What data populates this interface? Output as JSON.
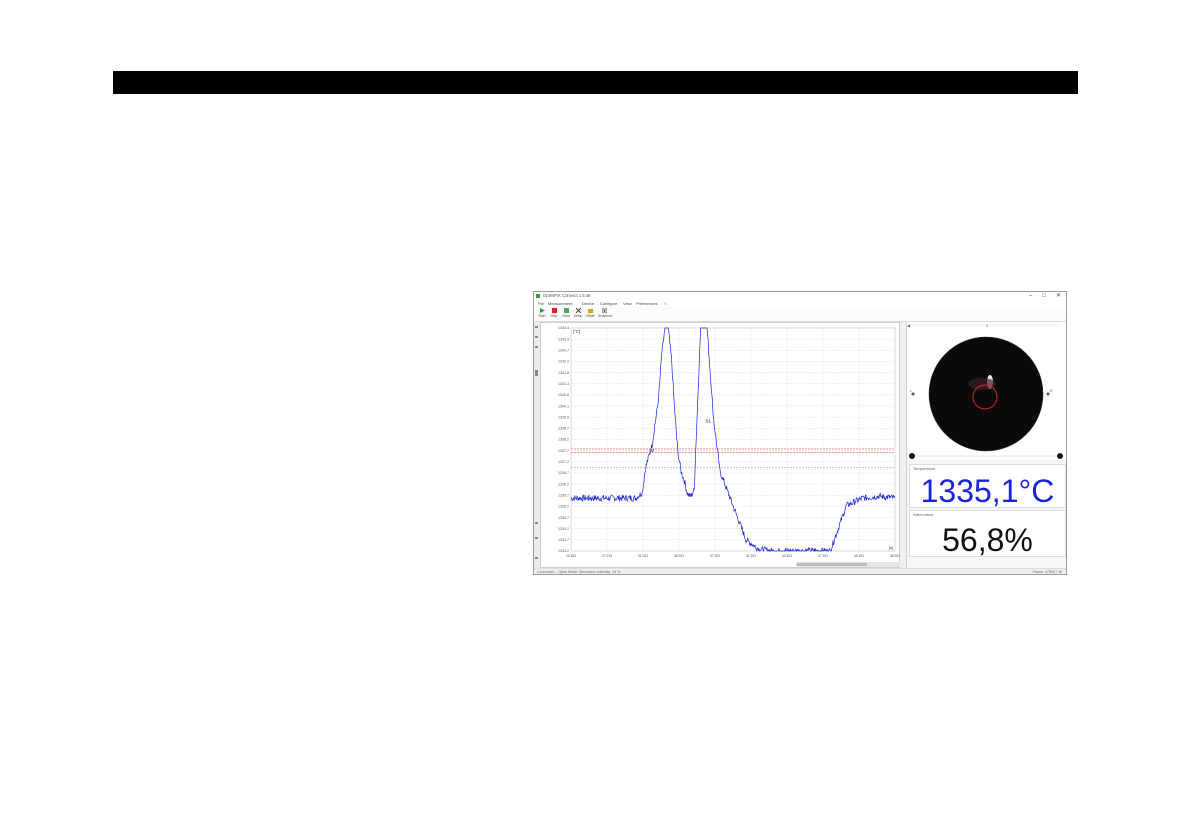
{
  "window": {
    "title": "OptrisPIX Connect 1.5.48",
    "controls": [
      "–",
      "□",
      "✕"
    ]
  },
  "menu": [
    "File",
    "Measurement",
    "Device",
    "Configure",
    "View",
    "Preferences",
    "?"
  ],
  "toolbar": [
    {
      "label": "Start",
      "icon": "play-icon",
      "color": "#1aa32a"
    },
    {
      "label": "Stop",
      "icon": "stop-icon",
      "color": "#e02020"
    },
    {
      "label": "Clear",
      "icon": "clear-icon",
      "color": "#4caf50"
    },
    {
      "label": "Setup",
      "icon": "tools-icon",
      "color": "#444444"
    },
    {
      "label": "Offset",
      "icon": "offset-icon",
      "color": "#e0a000"
    },
    {
      "label": "Snapshot",
      "icon": "camera-icon",
      "color": "#444444"
    }
  ],
  "plot": {
    "unit_label": "[°C]",
    "x_unit_label": "[s]"
  },
  "chart_data": {
    "type": "line",
    "title": "",
    "xlabel": "[s]",
    "ylabel": "[°C]",
    "ylim": [
      1332.8,
      1344.6
    ],
    "yticks": [
      "1344.4",
      "1343.5",
      "1342.7",
      "1342.2",
      "1341.8",
      "1341.3",
      "1340.8",
      "1340.1",
      "1339.5",
      "1338.7",
      "1338.2",
      "1337.7",
      "1337.2",
      "1336.7",
      "1336.2",
      "1335.7",
      "1335.2",
      "1334.7",
      "1334.2",
      "1333.7",
      "1333.2"
    ],
    "xticks": [
      "24.391",
      "27.219",
      "31.391",
      "35.391",
      "37.391",
      "41.391",
      "43.391",
      "47.391",
      "49.391",
      "48.391"
    ],
    "series": [
      {
        "color": "#1a24d8",
        "x": [
          0,
          20,
          22,
          23,
          25,
          27,
          28,
          29,
          30,
          31,
          32,
          33,
          34,
          35,
          36,
          37,
          38,
          40,
          42,
          44,
          46,
          50,
          54,
          58,
          62,
          66,
          70,
          80,
          85,
          90,
          95,
          100
        ],
        "values": [
          1335.6,
          1335.6,
          1335.9,
          1337.2,
          1338.4,
          1340.8,
          1343.2,
          1344.6,
          1344.6,
          1343.0,
          1340.2,
          1338.0,
          1337.0,
          1336.5,
          1335.8,
          1335.7,
          1336.0,
          1344.6,
          1344.6,
          1339.8,
          1337.0,
          1335.2,
          1333.4,
          1332.9,
          1332.8,
          1332.8,
          1332.8,
          1332.8,
          1335.2,
          1335.6,
          1335.7,
          1335.6
        ]
      }
    ],
    "threshold_lines": [
      {
        "color": "#e03030",
        "value": 1338.2
      },
      {
        "color": "#e03030",
        "value": 1338.0
      },
      {
        "color": "#888888",
        "value": 1337.2
      }
    ],
    "grid": true,
    "markers": [
      "S2",
      "S1"
    ]
  },
  "viewer": {
    "left_label": "L",
    "right_label": "R",
    "top_label": "0"
  },
  "temperature": {
    "label": "Temperature",
    "value": "1335,1°C"
  },
  "attenuation": {
    "label": "Attenuation",
    "value": "56,8%"
  },
  "statusbar": {
    "left": "Connected – Open   Mode: Simulation   Intensity: 94 %",
    "right": "Frame: 47593 / 48"
  }
}
